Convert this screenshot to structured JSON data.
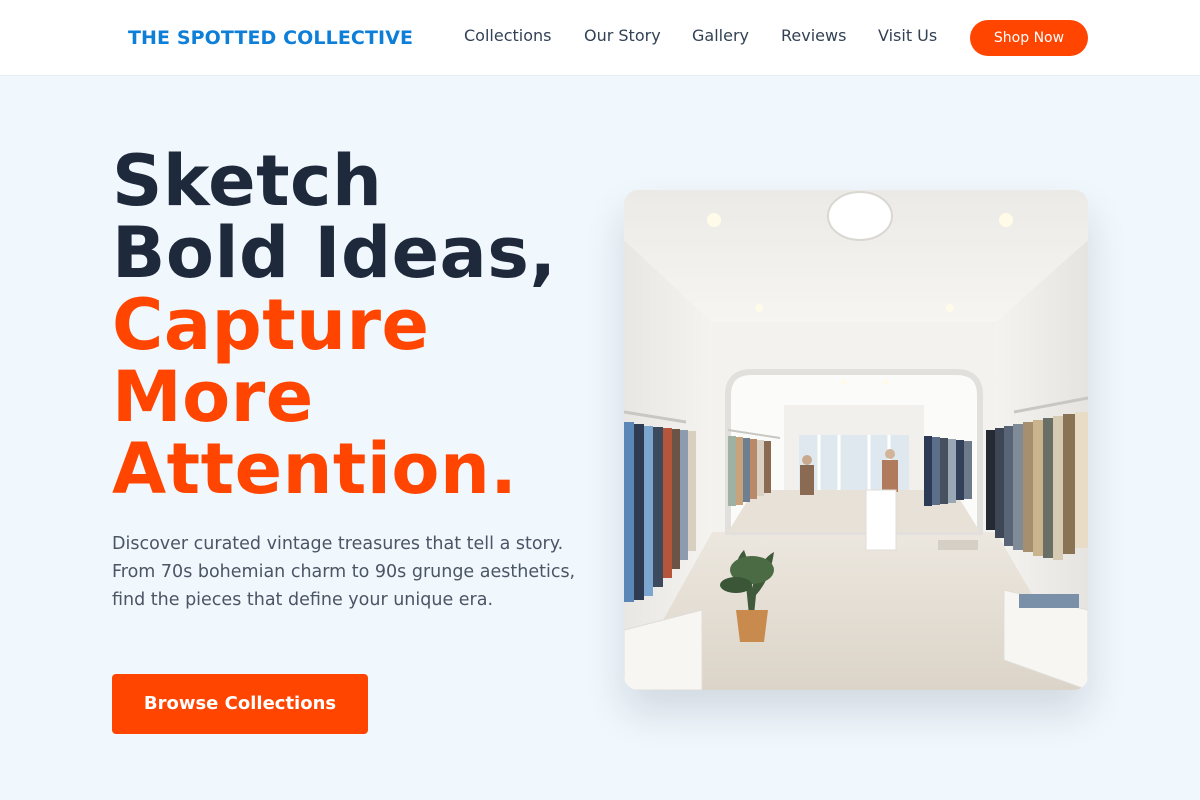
{
  "header": {
    "brand": "THE SPOTTED COLLECTIVE",
    "nav": [
      "Collections",
      "Our Story",
      "Gallery",
      "Reviews",
      "Visit Us"
    ],
    "cta": "Shop Now"
  },
  "hero": {
    "title_lines": [
      "Sketch",
      "Bold Ideas,",
      "Capture",
      "More",
      "Attention."
    ],
    "description": "Discover curated vintage treasures that tell a story. From 70s bohemian charm to 90s grunge aesthetics, find the pieces that define your unique era.",
    "cta": "Browse Collections"
  },
  "colors": {
    "brand": "#0d7fd9",
    "accent": "#ff4500",
    "dark_text": "#1e293b",
    "background": "#f0f7fd"
  }
}
